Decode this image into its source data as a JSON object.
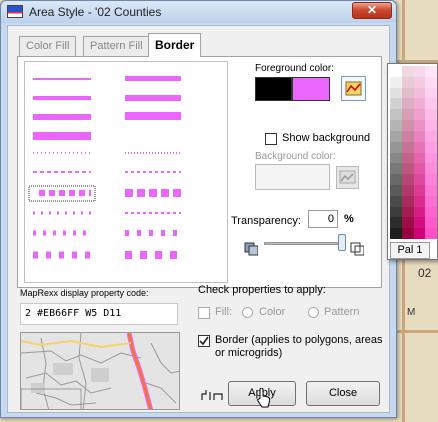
{
  "window": {
    "title": "Area Style - '02 Counties",
    "close_glyph": "✕"
  },
  "tabs": [
    {
      "label": "Color Fill",
      "active": false
    },
    {
      "label": "Pattern Fill",
      "active": false
    },
    {
      "label": "Border",
      "active": true
    }
  ],
  "border_tab": {
    "foreground_label": "Foreground color:",
    "foreground_colors": [
      "#000000",
      "#EB66FF"
    ],
    "show_background_label": "Show background",
    "show_background_checked": false,
    "background_label": "Background color:",
    "transparency_label": "Transparency:",
    "transparency_value": "0",
    "transparency_unit": "%",
    "line_color": "#EB66FF"
  },
  "display_code": {
    "label": "MapRexx display property code:",
    "value": "2  #EB66FF  W5  D11"
  },
  "apply_props": {
    "heading": "Check properties to apply:",
    "fill_label": "Fill:",
    "fill_checked": false,
    "color_option": "Color",
    "pattern_option": "Pattern",
    "border_label": "Border (applies to polygons, areas or microgrids)",
    "border_checked": true
  },
  "buttons": {
    "apply": "Apply",
    "close": "Close"
  },
  "palette": {
    "tab_label": "Pal 1"
  },
  "map": {
    "label_02": "02",
    "label_m": "M"
  }
}
